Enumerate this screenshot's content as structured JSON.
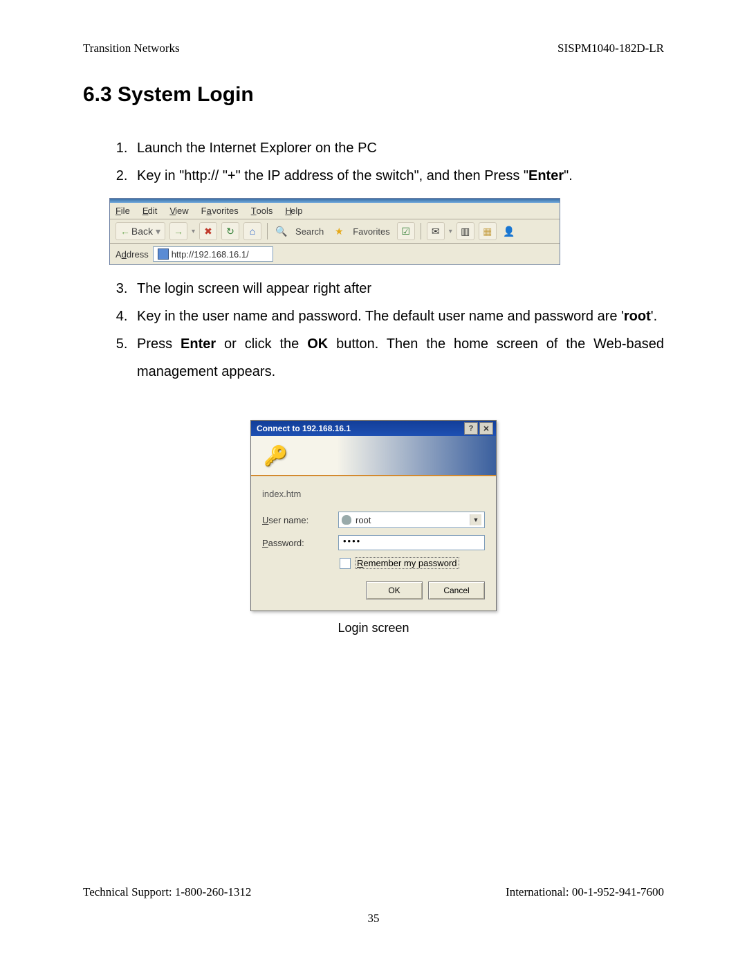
{
  "header": {
    "left": "Transition Networks",
    "right": "SISPM1040-182D-LR"
  },
  "section": {
    "heading": "6.3 System Login"
  },
  "steps": {
    "s1": "Launch the Internet Explorer on the PC",
    "s2_a": "Key in \"http:// \"+\" the IP address of the switch\", and then Press \"",
    "s2_bold": "Enter",
    "s2_b": "\".",
    "s3": "The login screen will appear right after",
    "s4_a": "Key in the user name and password. The default user name and password are '",
    "s4_bold": "root",
    "s4_b": "'.",
    "s5_a": "Press ",
    "s5_b1": "Enter",
    "s5_c": " or click the ",
    "s5_b2": "OK",
    "s5_d": " button.  Then the home screen of the Web-based management appears."
  },
  "ie": {
    "menu": {
      "file": "File",
      "edit": "Edit",
      "view": "View",
      "favorites": "Favorites",
      "tools": "Tools",
      "help": "Help"
    },
    "toolbar": {
      "back": "Back",
      "search": "Search",
      "favorites": "Favorites"
    },
    "address": {
      "label": "Address",
      "url": "http://192.168.16.1/"
    },
    "icons": {
      "back": "←",
      "forward": "→",
      "stop": "✖",
      "refresh": "↻",
      "home": "⌂",
      "search": "🔍",
      "favorites_star": "★",
      "media": "☑",
      "msg": "✉",
      "print": "▥",
      "user": "👤"
    }
  },
  "dialog": {
    "title": "Connect to 192.168.16.1",
    "help": "?",
    "close": "✕",
    "page": "index.htm",
    "user_label_u": "U",
    "user_label_rest": "ser name:",
    "pass_label_u": "P",
    "pass_label_rest": "assword:",
    "user_value": "root",
    "pass_value": "••••",
    "remember_u": "R",
    "remember_rest": "emember my password",
    "ok": "OK",
    "cancel": "Cancel"
  },
  "caption": "Login screen",
  "footer": {
    "left": "Technical Support: 1-800-260-1312",
    "right": "International: 00-1-952-941-7600",
    "page": "35"
  }
}
